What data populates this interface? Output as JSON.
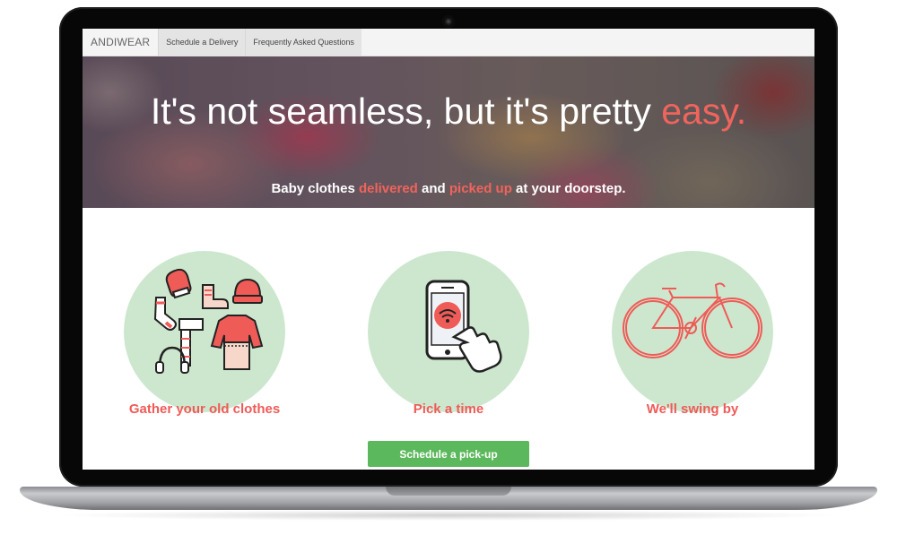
{
  "nav": {
    "brand": "ANDIWEAR",
    "links": [
      "Schedule a Delivery",
      "Frequently Asked Questions"
    ]
  },
  "hero": {
    "title_main": "It's not seamless, but it's pretty ",
    "title_accent": "easy.",
    "subtitle": {
      "part1": "Baby clothes ",
      "accent1": "delivered",
      "part2": " and ",
      "accent2": "picked up",
      "part3": " at your doorstep."
    }
  },
  "features": [
    {
      "label": "Gather your old clothes",
      "icon": "clothes-icon"
    },
    {
      "label": "Pick a time",
      "icon": "phone-tap-icon"
    },
    {
      "label": "We'll swing by",
      "icon": "bicycle-icon"
    }
  ],
  "cta": {
    "label": "Schedule a pick-up"
  },
  "colors": {
    "accent": "#f0645c",
    "feature_label": "#ef5b57",
    "circle": "#cde7cf",
    "button": "#5cb85c",
    "navbar": "#f4f4f4"
  }
}
